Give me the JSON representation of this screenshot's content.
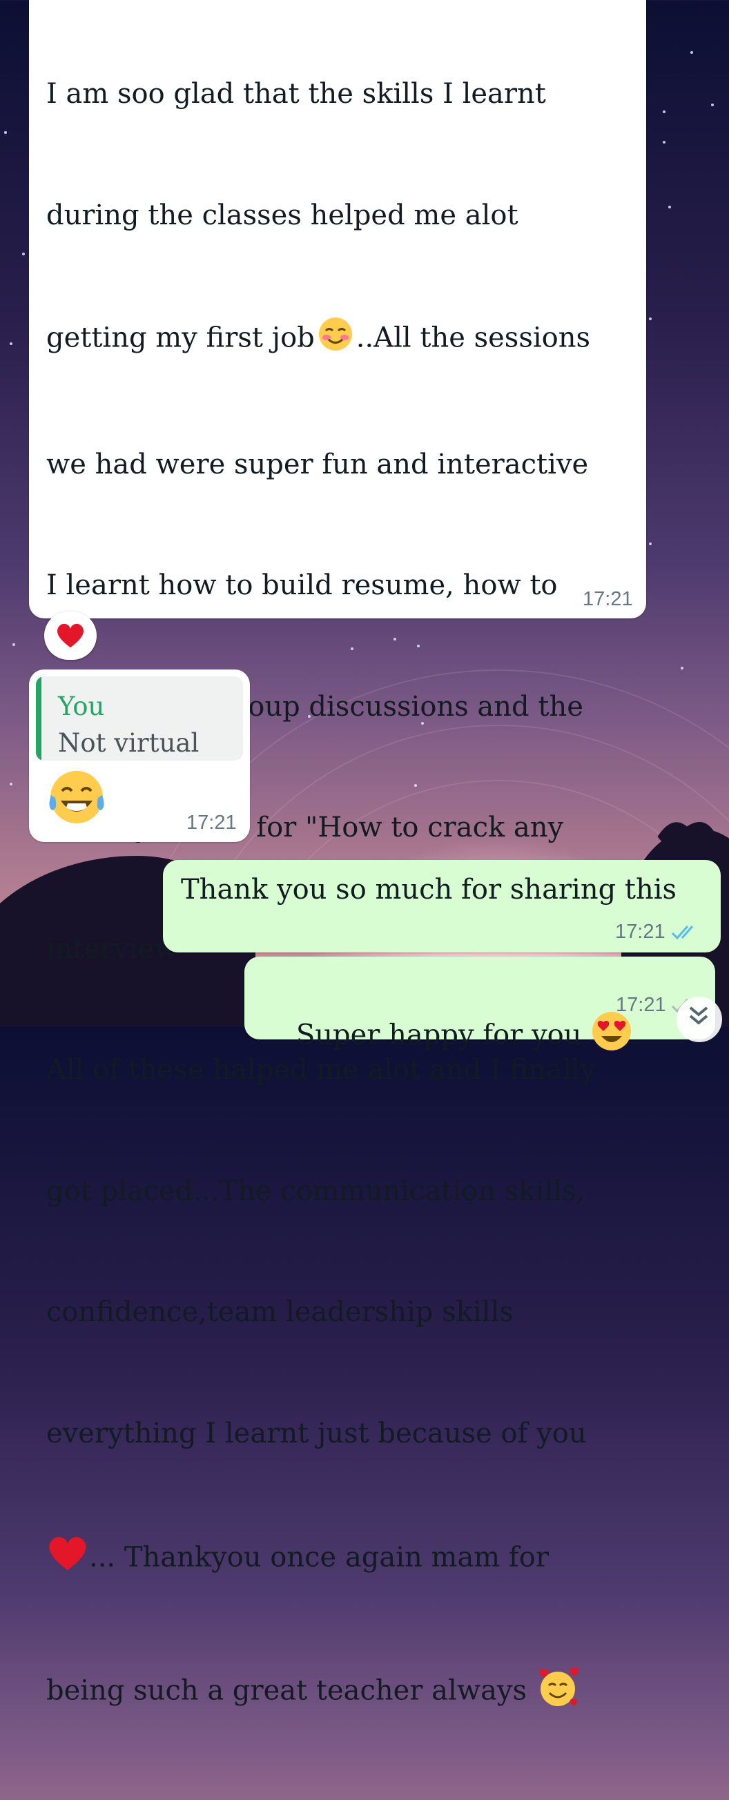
{
  "chat": {
    "messages": [
      {
        "direction": "incoming",
        "lines": [
          "I am soo glad that the skills I learnt",
          "during the classes helped me alot",
          "getting my first job",
          "..All the sessions",
          "we had were super fun and interactive",
          "I learnt how to build resume, how to",
          "be a part of group discussions and the",
          "tricks you told for \"How to crack any",
          "interview\"",
          "All of these halped me alot and I finally",
          "got placed...The communication skills,",
          "confidence,team leadership skills",
          "everything I learnt just because of you",
          "... Thankyou once again mam for",
          "being such a great teacher always"
        ],
        "time": "17:21",
        "reaction": "heart-icon"
      },
      {
        "direction": "incoming",
        "quote": {
          "author": "You",
          "text": "Not virtual"
        },
        "emoji": "tears-of-joy-icon",
        "time": "17:21"
      },
      {
        "direction": "outgoing",
        "text": "Thank you so much for sharing this",
        "time": "17:21",
        "status": "read"
      },
      {
        "direction": "outgoing",
        "text": "Super happy for you",
        "emoji": "heart-eyes-icon",
        "time": "17:21",
        "status": "delivered"
      }
    ]
  },
  "colors": {
    "incoming_bubble": "#ffffff",
    "outgoing_bubble": "#d9fdd3",
    "quote_accent": "#25a466",
    "read_ticks": "#53bdeb",
    "timestamp": "#667781"
  }
}
